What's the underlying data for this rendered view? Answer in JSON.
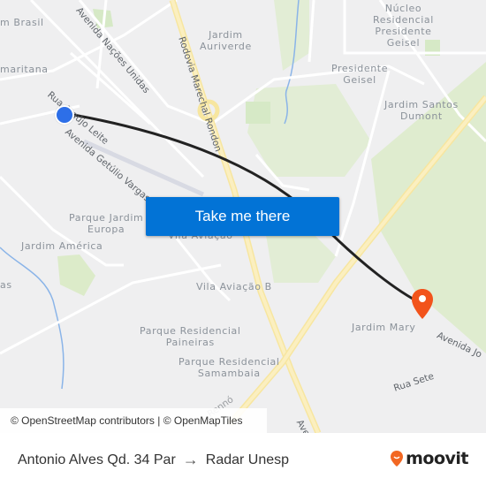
{
  "map": {
    "place_labels": [
      {
        "id": "jardim-brasil",
        "text": "m Brasil"
      },
      {
        "id": "samaritana",
        "text": "maritana"
      },
      {
        "id": "jardim-auriverde",
        "text": "Jardim\nAuriverde"
      },
      {
        "id": "nucleo-residencial",
        "text": "Núcleo\nResidencial\nPresidente\nGeisel"
      },
      {
        "id": "presidente-geisel",
        "text": "Presidente\nGeisel"
      },
      {
        "id": "jardim-santos-dumont",
        "text": "Jardim Santos\nDumont"
      },
      {
        "id": "parque-jardim-europa",
        "text": "Parque Jardim\nEuropa"
      },
      {
        "id": "jardim-america",
        "text": "Jardim América"
      },
      {
        "id": "vila-aviacao",
        "text": "Vila Aviação"
      },
      {
        "id": "vila-aviacao-b",
        "text": "Vila Aviação B"
      },
      {
        "id": "parque-residencial-paineiras",
        "text": "Parque Residencial\nPaineiras"
      },
      {
        "id": "parque-residencial-samambaia",
        "text": "Parque Residencial\nSamambaia"
      },
      {
        "id": "jardim-mary",
        "text": "Jardim Mary"
      },
      {
        "id": "as-partial",
        "text": "as"
      }
    ],
    "road_labels": [
      {
        "id": "avenida-nacoes-unidas",
        "text": "Avenida Nações Unidas"
      },
      {
        "id": "rodovia-marechal-rondon",
        "text": "Rodovia Marechal Rondon"
      },
      {
        "id": "rua-araujo-leite",
        "text": "Rua Araújo Leite"
      },
      {
        "id": "avenida-getulio-vargas",
        "text": "Avenida Getúlio Vargas"
      },
      {
        "id": "avenida-jo",
        "text": "Avenida Jo"
      },
      {
        "id": "rua-sete",
        "text": "Rua Sete"
      },
      {
        "id": "avenida-partial",
        "text": "Ave"
      },
      {
        "id": "renno-partial",
        "text": "Rennó"
      }
    ],
    "origin_marker": "origin-dot",
    "destination_marker": "destination-pin",
    "route_color": "#222222",
    "attribution": "© OpenStreetMap contributors | © OpenMapTiles"
  },
  "cta": {
    "label": "Take me there",
    "color": "#0273d6"
  },
  "footer": {
    "origin": "Antonio Alves Qd. 34 Par",
    "arrow_icon": "→",
    "destination": "Radar Unesp",
    "brand": "moovit",
    "brand_color": "#f26722"
  }
}
